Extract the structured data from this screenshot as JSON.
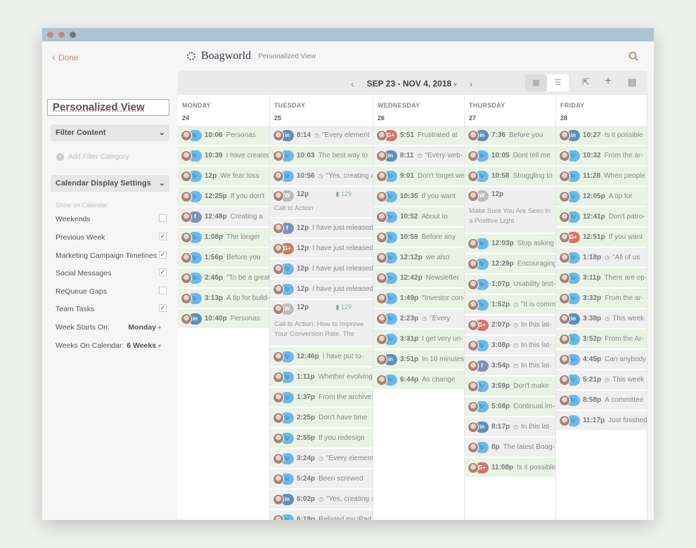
{
  "window": {
    "traffic_colors": [
      "#c9897a",
      "#c9897a",
      "#777777"
    ]
  },
  "appbar": {
    "done_label": "Done",
    "brand": "Boagworld",
    "view_name": "Personalized View"
  },
  "sidebar": {
    "view_name_value": "Personalized View",
    "filter_content": "Filter Content",
    "add_filter": "Add Filter Category",
    "display_settings": "Calendar Display Settings",
    "show_on_calendar": "Show on Calendar",
    "options": [
      {
        "label": "Weekends",
        "checked": false
      },
      {
        "label": "Previous Week",
        "checked": true
      },
      {
        "label": "Marketing Campaign Timelines",
        "checked": true
      },
      {
        "label": "Social Messages",
        "checked": true
      },
      {
        "label": "ReQueue Gaps",
        "checked": false
      },
      {
        "label": "Team Tasks",
        "checked": true
      }
    ],
    "week_starts_label": "Week Starts On:",
    "week_starts_value": "Monday",
    "weeks_on_cal_label": "Weeks On Calendar:",
    "weeks_on_cal_value": "6 Weeks"
  },
  "toolbar": {
    "date_range": "SEP 23 - NOV 4, 2018"
  },
  "columns": [
    {
      "day": "MONDAY",
      "num": "24",
      "posts": [
        {
          "t": "10:06",
          "x": "Personas",
          "n": "tw",
          "c": "g"
        },
        {
          "t": "10:39",
          "x": "I have created",
          "n": "tw",
          "c": "g"
        },
        {
          "t": "12p",
          "x": "We fear loss",
          "n": "tw",
          "c": "g"
        },
        {
          "t": "12:25p",
          "x": "If you don't",
          "n": "tw",
          "c": "g"
        },
        {
          "t": "12:48p",
          "x": "Creating a",
          "n": "fb",
          "c": "n"
        },
        {
          "t": "1:08p",
          "x": "The longer",
          "n": "tw",
          "c": "g"
        },
        {
          "t": "1:56p",
          "x": "Before you",
          "n": "tw",
          "c": "g"
        },
        {
          "t": "2:46p",
          "x": "\"To be a great",
          "n": "tw",
          "c": "g"
        },
        {
          "t": "3:13p",
          "x": "A tip for build-",
          "n": "tw",
          "c": "g"
        },
        {
          "t": "10:40p",
          "x": "Personas",
          "n": "li",
          "c": "g"
        }
      ]
    },
    {
      "day": "TUESDAY",
      "num": "25",
      "posts": [
        {
          "t": "8:14",
          "x": "\"Every element",
          "n": "li",
          "c": "n",
          "clk": true
        },
        {
          "t": "10:03",
          "x": "The best way to",
          "n": "tw",
          "c": "g"
        },
        {
          "t": "10:56",
          "x": "\"Yes, creating a",
          "n": "tw",
          "c": "n",
          "clk": true
        },
        {
          "big": true,
          "t": "12p",
          "stat": "129",
          "x": "Call to Action",
          "n": "wp",
          "c": "n"
        },
        {
          "t": "12p",
          "x": "I have just released",
          "n": "fb",
          "c": "n"
        },
        {
          "t": "12p",
          "x": "I have just released",
          "n": "gp",
          "c": "n"
        },
        {
          "t": "12p",
          "x": "I have just released",
          "n": "tw",
          "c": "n"
        },
        {
          "t": "12p",
          "x": "I have just released",
          "n": "tw",
          "c": "n"
        },
        {
          "big": true,
          "t": "12p",
          "stat": "129",
          "x": "Call to Action: How to Improve Your Conversion Rate. The",
          "n": "wp",
          "c": "n"
        },
        {
          "t": "12:46p",
          "x": "I have put to-",
          "n": "tw",
          "c": "g"
        },
        {
          "t": "1:11p",
          "x": "Whether evolving",
          "n": "tw",
          "c": "g"
        },
        {
          "t": "1:37p",
          "x": "From the archive:",
          "n": "tw",
          "c": "g"
        },
        {
          "t": "2:25p",
          "x": "Don't have time",
          "n": "tw",
          "c": "g"
        },
        {
          "t": "2:55p",
          "x": "If you redesign",
          "n": "tw",
          "c": "g"
        },
        {
          "t": "3:24p",
          "x": "\"Every element",
          "n": "tw",
          "c": "n",
          "clk": true
        },
        {
          "t": "5:24p",
          "x": "Been screwed",
          "n": "tw",
          "c": "n"
        },
        {
          "t": "6:02p",
          "x": "\"Yes, creating a",
          "n": "li",
          "c": "n",
          "clk": true
        },
        {
          "t": "6:18p",
          "x": "Relisted my iPad",
          "n": "tw",
          "c": "n"
        }
      ]
    },
    {
      "day": "WEDNESDAY",
      "num": "26",
      "posts": [
        {
          "t": "5:51",
          "x": "Frustrated at",
          "n": "gp",
          "c": "g"
        },
        {
          "t": "8:11",
          "x": "\"Every web-",
          "n": "li",
          "c": "n",
          "clk": true
        },
        {
          "t": "9:01",
          "x": "Don't forget we",
          "n": "tw",
          "c": "g"
        },
        {
          "t": "10:35",
          "x": "If you want",
          "n": "tw",
          "c": "g"
        },
        {
          "t": "10:52",
          "x": "About to",
          "n": "tw",
          "c": "g"
        },
        {
          "t": "10:59",
          "x": "Before any",
          "n": "tw",
          "c": "g"
        },
        {
          "t": "12:12p",
          "x": "we also",
          "n": "tw",
          "c": "g"
        },
        {
          "t": "12:42p",
          "x": "Newsletter",
          "n": "tw",
          "c": "g"
        },
        {
          "t": "1:49p",
          "x": "\"Investor con-",
          "n": "tw",
          "c": "g"
        },
        {
          "t": "2:23p",
          "x": "\"Every",
          "n": "tw",
          "c": "n",
          "clk": true
        },
        {
          "t": "3:31p",
          "x": "I get very un-",
          "n": "tw",
          "c": "g"
        },
        {
          "t": "3:51p",
          "x": "In 10 minutes",
          "n": "li",
          "c": "g"
        },
        {
          "t": "6:44p",
          "x": "As change",
          "n": "tw",
          "c": "g"
        }
      ]
    },
    {
      "day": "THURSDAY",
      "num": "27",
      "posts": [
        {
          "t": "7:36",
          "x": "Before you",
          "n": "li",
          "c": "g"
        },
        {
          "t": "10:05",
          "x": "Dont tell me",
          "n": "tw",
          "c": "g"
        },
        {
          "t": "10:58",
          "x": "Struggling to",
          "n": "tw",
          "c": "g"
        },
        {
          "big": true,
          "t": "12p",
          "x": "Make Sure You Are Seen in a Positive Light",
          "n": "wp",
          "c": "n",
          "single": true
        },
        {
          "t": "12:03p",
          "x": "Stop asking",
          "n": "tw",
          "c": "g"
        },
        {
          "t": "12:29p",
          "x": "Encouraging",
          "n": "tw",
          "c": "g"
        },
        {
          "t": "1:07p",
          "x": "Usability test-",
          "n": "tw",
          "c": "g"
        },
        {
          "t": "1:52p",
          "x": "\"It is common",
          "n": "tw",
          "c": "g",
          "clk": true
        },
        {
          "t": "2:07p",
          "x": "In this lat-",
          "n": "gp",
          "c": "n",
          "clk": true
        },
        {
          "t": "3:08p",
          "x": "In this lat-",
          "n": "tw",
          "c": "n",
          "clk": true
        },
        {
          "t": "3:54p",
          "x": "In this lat-",
          "n": "fb",
          "c": "n",
          "clk": true
        },
        {
          "t": "3:59p",
          "x": "Don't make",
          "n": "tw",
          "c": "g"
        },
        {
          "t": "5:08p",
          "x": "Continual im-",
          "n": "tw",
          "c": "g"
        },
        {
          "t": "8:17p",
          "x": "In this lat-",
          "n": "li",
          "c": "n",
          "clk": true
        },
        {
          "t": "8p",
          "x": "The latest Boag-",
          "n": "tw",
          "c": "n"
        },
        {
          "t": "11:08p",
          "x": "Is it possible",
          "n": "gp",
          "c": "g"
        }
      ]
    },
    {
      "day": "FRIDAY",
      "num": "28",
      "posts": [
        {
          "t": "10:27",
          "x": "Is it possible",
          "n": "li",
          "c": "g"
        },
        {
          "t": "10:32",
          "x": "From the ar-",
          "n": "tw",
          "c": "g"
        },
        {
          "t": "11:28",
          "x": "When people",
          "n": "tw",
          "c": "g"
        },
        {
          "t": "12:05p",
          "x": "A tip for",
          "n": "tw",
          "c": "g"
        },
        {
          "t": "12:41p",
          "x": "Don't patro-",
          "n": "tw",
          "c": "g"
        },
        {
          "t": "12:51p",
          "x": "If you want",
          "n": "gp",
          "c": "g"
        },
        {
          "t": "1:18p",
          "x": "\"All of us",
          "n": "tw",
          "c": "n",
          "clk": true
        },
        {
          "t": "3:11p",
          "x": "There are op-",
          "n": "tw",
          "c": "g"
        },
        {
          "t": "3:32p",
          "x": "From the ar-",
          "n": "tw",
          "c": "g"
        },
        {
          "t": "3:38p",
          "x": "This week",
          "n": "li",
          "c": "n",
          "clk": true
        },
        {
          "t": "3:52p",
          "x": "From the Ar-",
          "n": "tw",
          "c": "g"
        },
        {
          "t": "4:45p",
          "x": "Can anybody",
          "n": "tw",
          "c": "n"
        },
        {
          "t": "5:21p",
          "x": "This week",
          "n": "tw",
          "c": "n",
          "clk": true
        },
        {
          "t": "8:58p",
          "x": "A committee",
          "n": "tw",
          "c": "n"
        },
        {
          "t": "11:17p",
          "x": "Just finished",
          "n": "tw",
          "c": "n"
        }
      ]
    }
  ]
}
